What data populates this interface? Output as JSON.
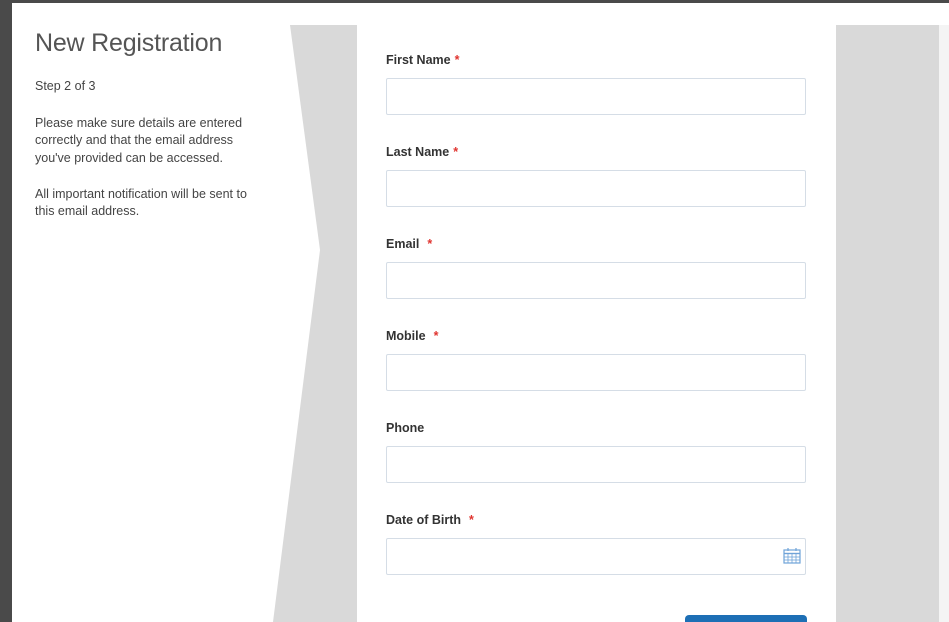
{
  "info": {
    "title": "New Registration",
    "step": "Step 2 of 3",
    "paragraph1": "Please make sure details are entered correctly and that the email address you've provided can be accessed.",
    "paragraph2": "All important notification will be sent to this email address."
  },
  "form": {
    "required_marker": "*",
    "fields": [
      {
        "label": "First Name",
        "required": true,
        "value": "",
        "placeholder": ""
      },
      {
        "label": "Last Name",
        "required": true,
        "value": "",
        "placeholder": ""
      },
      {
        "label": "Email",
        "required": true,
        "value": "",
        "placeholder": ""
      },
      {
        "label": "Mobile",
        "required": true,
        "value": "",
        "placeholder": ""
      },
      {
        "label": "Phone",
        "required": false,
        "value": "",
        "placeholder": ""
      },
      {
        "label": "Date of Birth",
        "required": true,
        "value": "",
        "placeholder": "",
        "icon": "calendar-icon"
      }
    ]
  },
  "colors": {
    "frame": "#4a4a4a",
    "side_panel": "#d9d9d9",
    "required": "#e0342f",
    "input_border": "#d5dde6",
    "primary_button": "#1d6fb5",
    "calendar_icon": "#6fa3d8"
  }
}
